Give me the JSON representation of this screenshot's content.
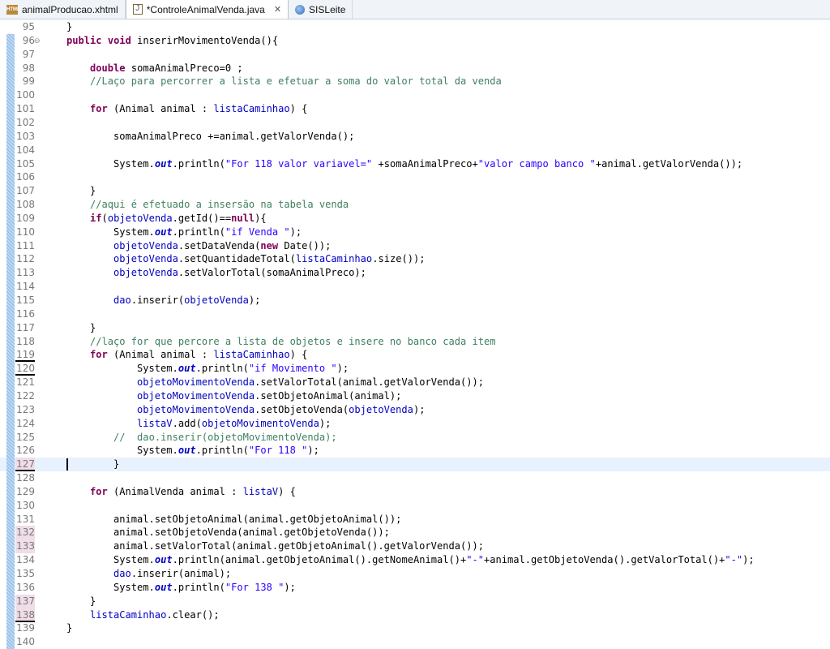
{
  "tabs": [
    {
      "label": "animalProducao.xhtml",
      "icon": "html-file-icon",
      "active": false
    },
    {
      "label": "*ControleAnimalVenda.java",
      "icon": "java-file-icon",
      "active": true
    },
    {
      "label": "SISLeite",
      "icon": "globe-icon",
      "active": false
    }
  ],
  "editor": {
    "lines": [
      {
        "n": "95",
        "t": [
          [
            "p",
            "    }"
          ]
        ]
      },
      {
        "n": "96",
        "t": [
          [
            "p",
            "    "
          ],
          [
            "k",
            "public"
          ],
          [
            "p",
            " "
          ],
          [
            "k",
            "void"
          ],
          [
            "p",
            " inserirMovimentoVenda(){"
          ]
        ]
      },
      {
        "n": "97",
        "t": []
      },
      {
        "n": "98",
        "t": [
          [
            "p",
            "        "
          ],
          [
            "k",
            "double"
          ],
          [
            "p",
            " somaAnimalPreco=0 ;"
          ]
        ]
      },
      {
        "n": "99",
        "t": [
          [
            "p",
            "        "
          ],
          [
            "c",
            "//Laço para percorrer a lista e efetuar a soma do valor total da venda"
          ]
        ]
      },
      {
        "n": "100",
        "t": []
      },
      {
        "n": "101",
        "t": [
          [
            "p",
            "        "
          ],
          [
            "k",
            "for"
          ],
          [
            "p",
            " (Animal animal : "
          ],
          [
            "f",
            "listaCaminhao"
          ],
          [
            "p",
            ") {"
          ]
        ]
      },
      {
        "n": "102",
        "t": []
      },
      {
        "n": "103",
        "t": [
          [
            "p",
            "            somaAnimalPreco +=animal.getValorVenda();"
          ]
        ]
      },
      {
        "n": "104",
        "t": []
      },
      {
        "n": "105",
        "t": [
          [
            "p",
            "            System."
          ],
          [
            "s",
            "out"
          ],
          [
            "p",
            ".println("
          ],
          [
            "str",
            "\"For 118 valor variavel=\""
          ],
          [
            "p",
            " +somaAnimalPreco+"
          ],
          [
            "str",
            "\"valor campo banco \""
          ],
          [
            "p",
            "+animal.getValorVenda());"
          ]
        ]
      },
      {
        "n": "106",
        "t": []
      },
      {
        "n": "107",
        "t": [
          [
            "p",
            "        }"
          ]
        ]
      },
      {
        "n": "108",
        "t": [
          [
            "p",
            "        "
          ],
          [
            "c",
            "//aqui é efetuado a insersão na tabela venda"
          ]
        ]
      },
      {
        "n": "109",
        "t": [
          [
            "p",
            "        "
          ],
          [
            "k",
            "if"
          ],
          [
            "p",
            "("
          ],
          [
            "f",
            "objetoVenda"
          ],
          [
            "p",
            ".getId()=="
          ],
          [
            "k",
            "null"
          ],
          [
            "p",
            "){"
          ]
        ]
      },
      {
        "n": "110",
        "t": [
          [
            "p",
            "            System."
          ],
          [
            "s",
            "out"
          ],
          [
            "p",
            ".println("
          ],
          [
            "str",
            "\"if Venda \""
          ],
          [
            "p",
            ");"
          ]
        ]
      },
      {
        "n": "111",
        "t": [
          [
            "p",
            "            "
          ],
          [
            "f",
            "objetoVenda"
          ],
          [
            "p",
            ".setDataVenda("
          ],
          [
            "k",
            "new"
          ],
          [
            "p",
            " Date());"
          ]
        ]
      },
      {
        "n": "112",
        "t": [
          [
            "p",
            "            "
          ],
          [
            "f",
            "objetoVenda"
          ],
          [
            "p",
            ".setQuantidadeTotal("
          ],
          [
            "f",
            "listaCaminhao"
          ],
          [
            "p",
            ".size());"
          ]
        ]
      },
      {
        "n": "113",
        "t": [
          [
            "p",
            "            "
          ],
          [
            "f",
            "objetoVenda"
          ],
          [
            "p",
            ".setValorTotal(somaAnimalPreco);"
          ]
        ]
      },
      {
        "n": "114",
        "t": []
      },
      {
        "n": "115",
        "t": [
          [
            "p",
            "            "
          ],
          [
            "f",
            "dao"
          ],
          [
            "p",
            ".inserir("
          ],
          [
            "f",
            "objetoVenda"
          ],
          [
            "p",
            ");"
          ]
        ]
      },
      {
        "n": "116",
        "t": []
      },
      {
        "n": "117",
        "t": [
          [
            "p",
            "        }"
          ]
        ]
      },
      {
        "n": "118",
        "t": [
          [
            "p",
            "        "
          ],
          [
            "c",
            "//laço for que percore a lista de objetos e insere no banco cada item"
          ]
        ]
      },
      {
        "n": "119",
        "t": [
          [
            "p",
            "        "
          ],
          [
            "k",
            "for"
          ],
          [
            "p",
            " (Animal animal : "
          ],
          [
            "f",
            "listaCaminhao"
          ],
          [
            "p",
            ") {"
          ]
        ]
      },
      {
        "n": "120",
        "t": [
          [
            "p",
            "                System."
          ],
          [
            "s",
            "out"
          ],
          [
            "p",
            ".println("
          ],
          [
            "str",
            "\"if Movimento \""
          ],
          [
            "p",
            ");"
          ]
        ]
      },
      {
        "n": "121",
        "t": [
          [
            "p",
            "                "
          ],
          [
            "f",
            "objetoMovimentoVenda"
          ],
          [
            "p",
            ".setValorTotal(animal.getValorVenda());"
          ]
        ]
      },
      {
        "n": "122",
        "t": [
          [
            "p",
            "                "
          ],
          [
            "f",
            "objetoMovimentoVenda"
          ],
          [
            "p",
            ".setObjetoAnimal(animal);"
          ]
        ]
      },
      {
        "n": "123",
        "t": [
          [
            "p",
            "                "
          ],
          [
            "f",
            "objetoMovimentoVenda"
          ],
          [
            "p",
            ".setObjetoVenda("
          ],
          [
            "f",
            "objetoVenda"
          ],
          [
            "p",
            ");"
          ]
        ]
      },
      {
        "n": "124",
        "t": [
          [
            "p",
            "                "
          ],
          [
            "f",
            "listaV"
          ],
          [
            "p",
            ".add("
          ],
          [
            "f",
            "objetoMovimentoVenda"
          ],
          [
            "p",
            ");"
          ]
        ]
      },
      {
        "n": "125",
        "t": [
          [
            "p",
            "            "
          ],
          [
            "c",
            "//  dao.inserir(objetoMovimentoVenda);"
          ]
        ]
      },
      {
        "n": "126",
        "t": [
          [
            "p",
            "                System."
          ],
          [
            "s",
            "out"
          ],
          [
            "p",
            ".println("
          ],
          [
            "str",
            "\"For 118 \""
          ],
          [
            "p",
            ");"
          ]
        ]
      },
      {
        "n": "127",
        "t": [
          [
            "p",
            "            }"
          ]
        ]
      },
      {
        "n": "128",
        "t": []
      },
      {
        "n": "129",
        "t": [
          [
            "p",
            "        "
          ],
          [
            "k",
            "for"
          ],
          [
            "p",
            " (AnimalVenda animal : "
          ],
          [
            "f",
            "listaV"
          ],
          [
            "p",
            ") {"
          ]
        ]
      },
      {
        "n": "130",
        "t": []
      },
      {
        "n": "131",
        "t": [
          [
            "p",
            "            animal.setObjetoAnimal(animal.getObjetoAnimal());"
          ]
        ]
      },
      {
        "n": "132",
        "t": [
          [
            "p",
            "            animal.setObjetoVenda(animal.getObjetoVenda());"
          ]
        ]
      },
      {
        "n": "133",
        "t": [
          [
            "p",
            "            animal.setValorTotal(animal.getObjetoAnimal().getValorVenda());"
          ]
        ]
      },
      {
        "n": "134",
        "t": [
          [
            "p",
            "            System."
          ],
          [
            "s",
            "out"
          ],
          [
            "p",
            ".println(animal.getObjetoAnimal().getNomeAnimal()+"
          ],
          [
            "str",
            "\"-\""
          ],
          [
            "p",
            "+animal.getObjetoVenda().getValorTotal()+"
          ],
          [
            "str",
            "\"-\""
          ],
          [
            "p",
            ");"
          ]
        ]
      },
      {
        "n": "135",
        "t": [
          [
            "p",
            "            "
          ],
          [
            "f",
            "dao"
          ],
          [
            "p",
            ".inserir(animal);"
          ]
        ]
      },
      {
        "n": "136",
        "t": [
          [
            "p",
            "            System."
          ],
          [
            "s",
            "out"
          ],
          [
            "p",
            ".println("
          ],
          [
            "str",
            "\"For 138 \""
          ],
          [
            "p",
            ");"
          ]
        ]
      },
      {
        "n": "137",
        "t": [
          [
            "p",
            "        }"
          ]
        ]
      },
      {
        "n": "138",
        "t": [
          [
            "p",
            "        "
          ],
          [
            "f",
            "listaCaminhao"
          ],
          [
            "p",
            ".clear();"
          ]
        ]
      },
      {
        "n": "139",
        "t": [
          [
            "p",
            "    }"
          ]
        ]
      },
      {
        "n": "140",
        "t": []
      }
    ]
  }
}
